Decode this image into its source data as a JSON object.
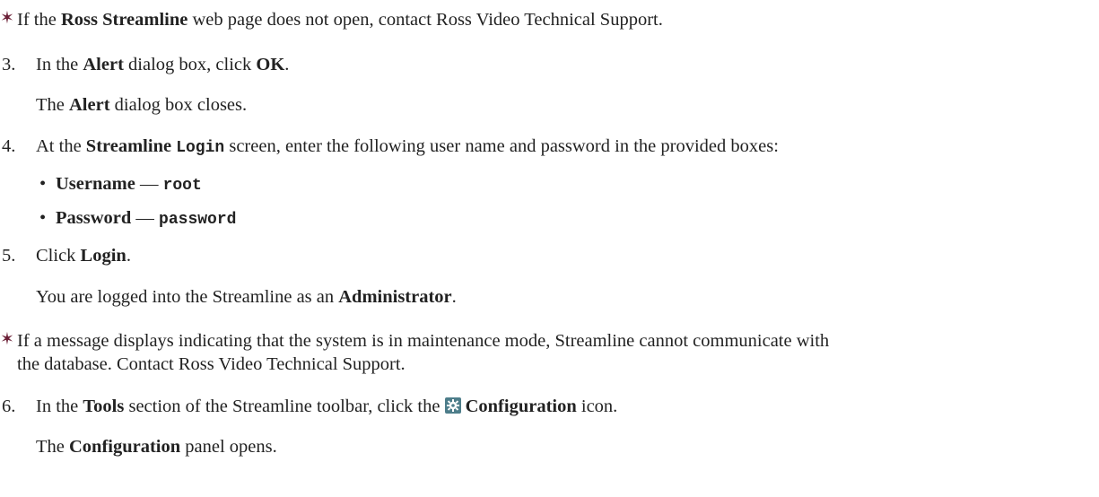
{
  "note1": {
    "icon": "star-icon",
    "t1": "If the ",
    "b1": "Ross Streamline",
    "t2": " web page does not open, contact Ross Video Technical Support."
  },
  "step3": {
    "number": "3.",
    "t1": "In the ",
    "b1": "Alert",
    "t2": " dialog box, click ",
    "b2": "OK",
    "t3": ".",
    "result_t1": "The ",
    "result_b1": "Alert",
    "result_t2": " dialog box closes."
  },
  "step4": {
    "number": "4.",
    "t1": "At the ",
    "b1": "Streamline ",
    "m1": "Login",
    "t2": " screen, enter the following user name and password in the provided boxes:",
    "bullets": [
      {
        "bullet": "•",
        "label": "Username",
        "dash": " — ",
        "value": "root"
      },
      {
        "bullet": "•",
        "label": "Password",
        "dash": " — ",
        "value": "password"
      }
    ]
  },
  "step5": {
    "number": "5.",
    "t1": "Click ",
    "b1": "Login",
    "t2": ".",
    "result_t1": "You are logged into the Streamline as an ",
    "result_b1": "Administrator",
    "result_t2": "."
  },
  "note2": {
    "icon": "star-icon",
    "line1": "If a message displays indicating that the system is in maintenance mode, Streamline cannot communicate with",
    "line2": "the database. Contact Ross Video Technical Support."
  },
  "step6": {
    "number": "6.",
    "t1": "In the ",
    "b1": "Tools",
    "t2": " section of the Streamline toolbar, click the ",
    "icon": "gear-icon",
    "b2": "Configuration",
    "t3": " icon.",
    "result_t1": "The ",
    "result_b1": "Configuration",
    "result_t2": " panel opens."
  },
  "colors": {
    "star": "#6b1f36",
    "gear_bg": "#4d7d8a"
  }
}
